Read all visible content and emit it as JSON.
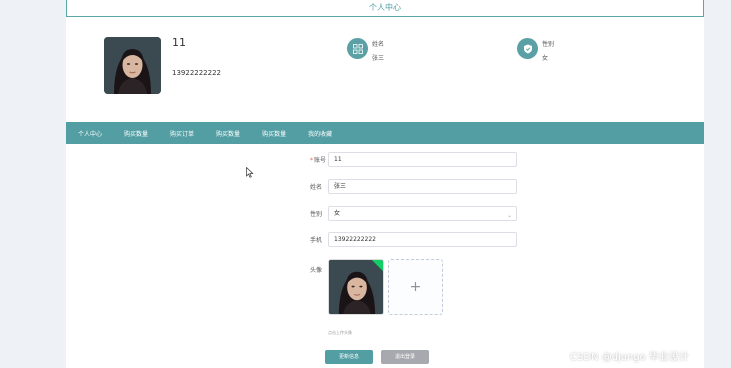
{
  "page": {
    "title": "个人中心"
  },
  "profile": {
    "account": "11",
    "phone": "13922222222",
    "name_label": "姓名",
    "name_value": "张三",
    "gender_label": "性别",
    "gender_value": "女",
    "avatar_icon": "person-photo"
  },
  "nav": {
    "items": [
      "个人中心",
      "购买数量",
      "购买订单",
      "购买数量",
      "购买数量",
      "我的收藏"
    ]
  },
  "form": {
    "account_label": "账号",
    "account_value": "11",
    "name_label": "姓名",
    "name_value": "张三",
    "gender_label": "性别",
    "gender_value": "女",
    "phone_label": "手机",
    "phone_value": "13922222222",
    "avatar_label": "头像",
    "upload_tip": "点击上传头像",
    "add_symbol": "+"
  },
  "buttons": {
    "update": "更新信息",
    "logout": "退出登录"
  },
  "watermark": "CSDN @django 毕业设计",
  "colors": {
    "accent": "#529ea3",
    "required": "#e55555",
    "upload_success": "#13ce66",
    "logout_button": "#a6a9ad"
  }
}
